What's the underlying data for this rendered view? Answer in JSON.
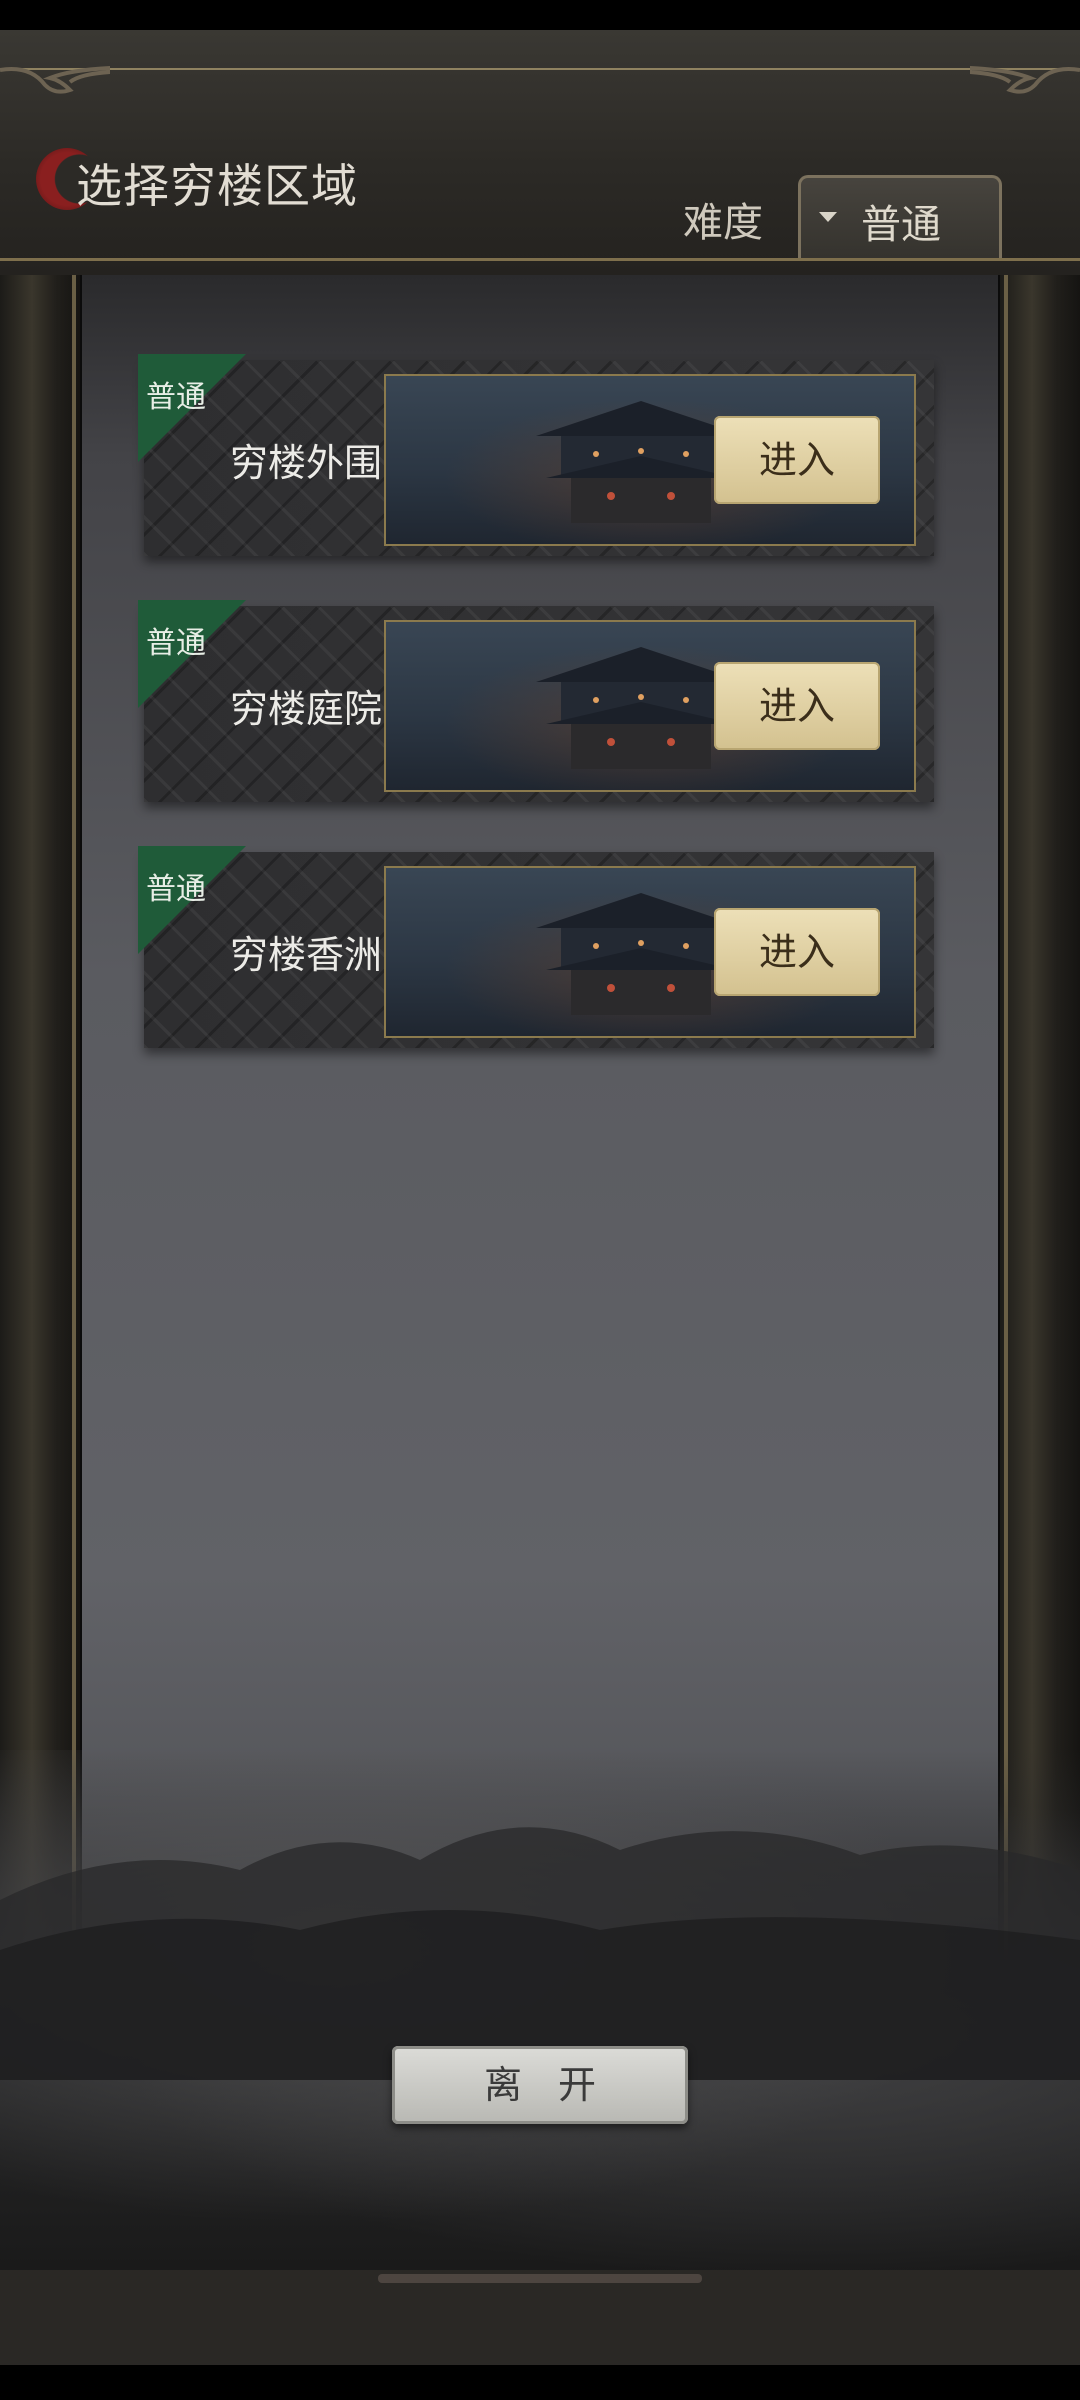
{
  "header": {
    "title": "选择穷楼区域",
    "difficulty_label": "难度",
    "difficulty_value": "普通"
  },
  "areas": [
    {
      "tag": "普通",
      "name": "穷楼外围",
      "enter_label": "进入"
    },
    {
      "tag": "普通",
      "name": "穷楼庭院",
      "enter_label": "进入"
    },
    {
      "tag": "普通",
      "name": "穷楼香洲",
      "enter_label": "进入"
    }
  ],
  "footer": {
    "leave_label": "离开"
  },
  "colors": {
    "tag_green": "#1f5b39",
    "button_gold": "#d3c18f",
    "title_text": "#e2ddd3"
  }
}
